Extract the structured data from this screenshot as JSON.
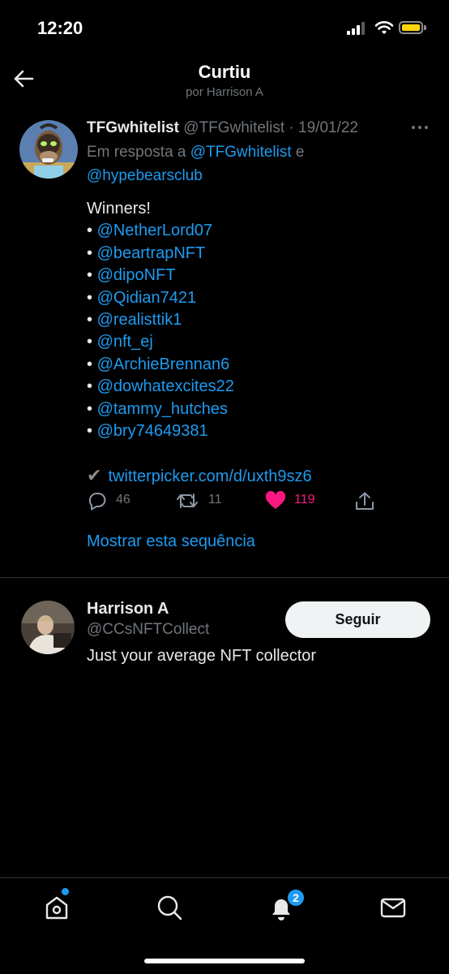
{
  "status_bar": {
    "time": "12:20"
  },
  "header": {
    "title": "Curtiu",
    "subtitle": "por Harrison A"
  },
  "tweet": {
    "display_name": "TFGwhitelist",
    "handle": "@TFGwhitelist",
    "separator": " · ",
    "date": "19/01/22",
    "reply_prefix": "Em resposta a",
    "reply_user_1": "@TFGwhitelist",
    "reply_joiner": " e",
    "reply_user_2": "@hypebearsclub",
    "text_intro": "Winners!",
    "bullet": "• ",
    "winners": [
      "@NetherLord07",
      "@beartrapNFT",
      "@dipoNFT",
      "@Qidian7421",
      "@realisttik1",
      "@nft_ej",
      "@ArchieBrennan6",
      "@dowhatexcites22",
      "@tammy_hutches",
      "@bry74649381"
    ],
    "check_glyph": "✔",
    "link": "twitterpicker.com/d/uxth9sz6",
    "reply_count": "46",
    "retweet_count": "11",
    "like_count": "119",
    "show_thread": "Mostrar esta sequência"
  },
  "user": {
    "name": "Harrison A",
    "handle": "@CCsNFTCollect",
    "bio": "Just your average NFT collector",
    "follow_label": "Seguir"
  },
  "tabbar": {
    "notifications_badge": "2"
  },
  "colors": {
    "accent": "#1d9bf0",
    "like": "#f91880",
    "muted": "#71767b",
    "background": "#000000"
  },
  "icons": {
    "back": "arrow-left-icon",
    "more": "more-horizontal-icon",
    "reply": "comment-icon",
    "retweet": "retweet-icon",
    "like": "heart-icon",
    "share": "share-icon",
    "home": "home-icon",
    "search": "search-icon",
    "notifications": "bell-icon",
    "messages": "mail-icon"
  }
}
